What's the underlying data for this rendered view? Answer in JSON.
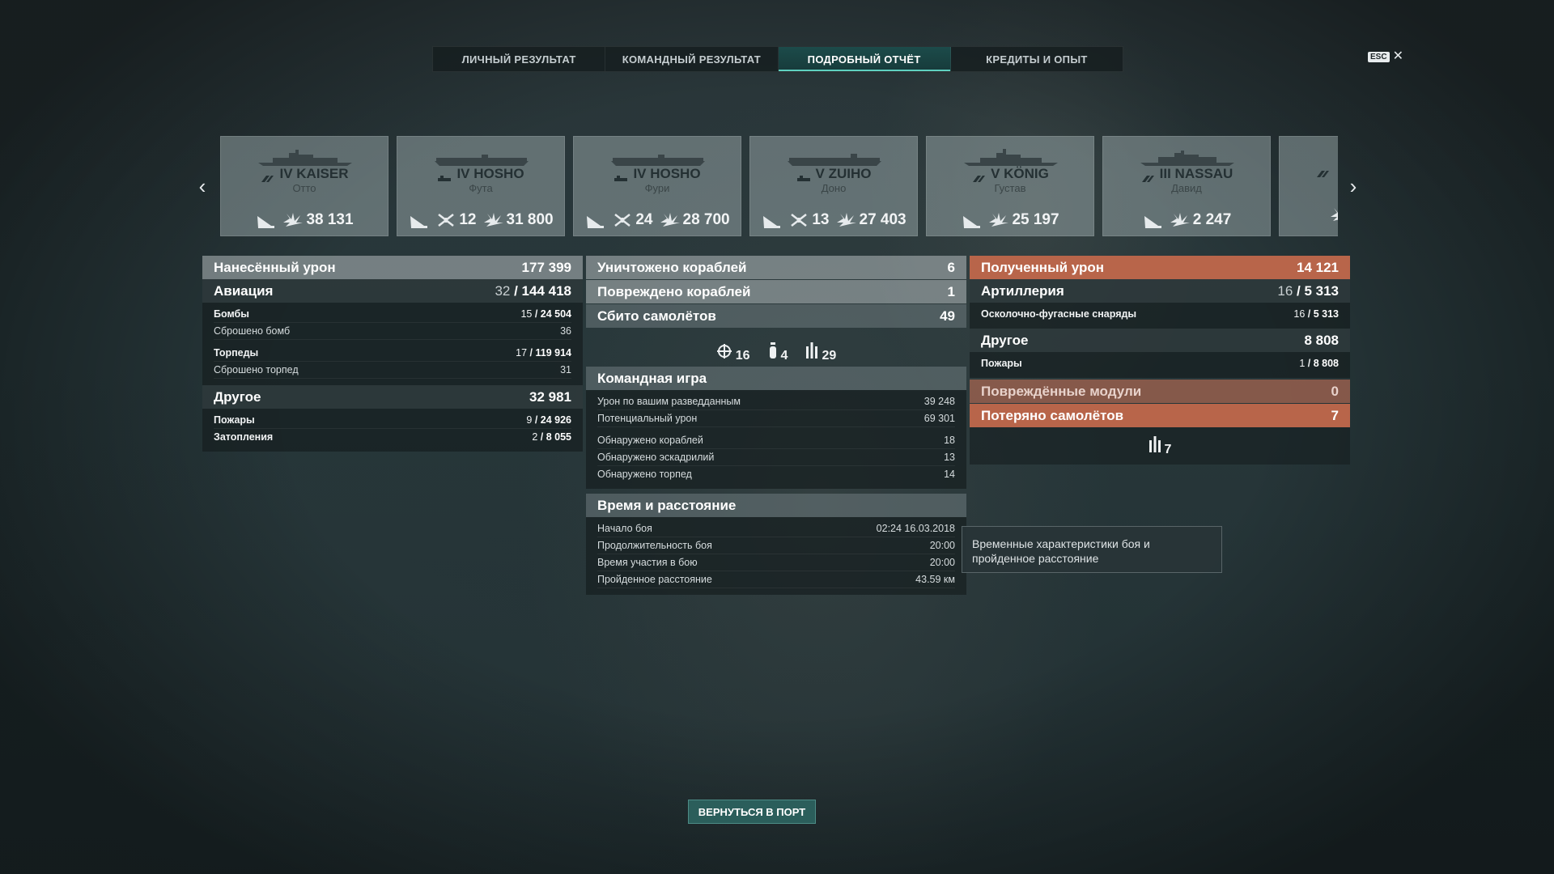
{
  "tabs": [
    {
      "label": "ЛИЧНЫЙ РЕЗУЛЬТАТ",
      "active": false
    },
    {
      "label": "КОМАНДНЫЙ РЕЗУЛЬТАТ",
      "active": false
    },
    {
      "label": "ПОДРОБНЫЙ ОТЧЁТ",
      "active": true
    },
    {
      "label": "КРЕДИТЫ И ОПЫТ",
      "active": false
    }
  ],
  "esc": {
    "key": "ESC",
    "close": "✕"
  },
  "ships": [
    {
      "tier_name": "IV KAISER",
      "player": "Отто",
      "planes": "",
      "damage": "38 131"
    },
    {
      "tier_name": "IV HOSHO",
      "player": "Фута",
      "planes": "12",
      "damage": "31 800"
    },
    {
      "tier_name": "IV HOSHO",
      "player": "Фури",
      "planes": "24",
      "damage": "28 700"
    },
    {
      "tier_name": "V ZUIHO",
      "player": "Доно",
      "planes": "13",
      "damage": "27 403"
    },
    {
      "tier_name": "V KÖNIG",
      "player": "Густав",
      "planes": "",
      "damage": "25 197"
    },
    {
      "tier_name": "III NASSAU",
      "player": "Давид",
      "planes": "",
      "damage": "2 247"
    }
  ],
  "left_panel": {
    "damage_dealt": {
      "label": "Нанесённый урон",
      "value": "177 399"
    },
    "aviation": {
      "label": "Авиация",
      "hits": "32",
      "value": "144 418"
    },
    "bombs": {
      "label": "Бомбы",
      "hits": "15",
      "value": "24 504"
    },
    "bombs_dropped": {
      "label": "Сброшено бомб",
      "value": "36"
    },
    "torpedoes": {
      "label": "Торпеды",
      "hits": "17",
      "value": "119 914"
    },
    "torpedoes_dropped": {
      "label": "Сброшено торпед",
      "value": "31"
    },
    "other": {
      "label": "Другое",
      "value": "32 981"
    },
    "fires": {
      "label": "Пожары",
      "hits": "9",
      "value": "24 926"
    },
    "flooding": {
      "label": "Затопления",
      "hits": "2",
      "value": "8 055"
    }
  },
  "middle_panel": {
    "destroyed": {
      "label": "Уничтожено кораблей",
      "value": "6"
    },
    "damaged": {
      "label": "Повреждено кораблей",
      "value": "1"
    },
    "planes_shot": {
      "label": "Сбито самолётов",
      "value": "49"
    },
    "plane_icons": {
      "fighters": "16",
      "bombers": "4",
      "torpedo": "29"
    },
    "team_play": {
      "label": "Командная игра",
      "rows": [
        {
          "label": "Урон по вашим разведданным",
          "value": "39 248"
        },
        {
          "label": "Потенциальный урон",
          "value": "69 301"
        },
        {
          "label": "Обнаружено кораблей",
          "value": "18"
        },
        {
          "label": "Обнаружено эскадрилий",
          "value": "13"
        },
        {
          "label": "Обнаружено торпед",
          "value": "14"
        }
      ]
    },
    "time": {
      "label": "Время и расстояние",
      "rows": [
        {
          "label": "Начало боя",
          "value": "02:24  16.03.2018"
        },
        {
          "label": "Продолжительность боя",
          "value": "20:00"
        },
        {
          "label": "Время участия в бою",
          "value": "20:00"
        },
        {
          "label": "Пройденное расстояние",
          "value": "43.59 км"
        }
      ]
    }
  },
  "right_panel": {
    "damage_received": {
      "label": "Полученный урон",
      "value": "14 121"
    },
    "artillery": {
      "label": "Артиллерия",
      "hits": "16",
      "value": "5 313"
    },
    "he_shells": {
      "label": "Осколочно-фугасные снаряды",
      "hits": "16",
      "value": "5 313"
    },
    "other": {
      "label": "Другое",
      "value": "8 808"
    },
    "fires": {
      "label": "Пожары",
      "hits": "1",
      "value": "8 808"
    },
    "modules": {
      "label": "Повреждённые модули",
      "value": "0"
    },
    "planes_lost": {
      "label": "Потеряно самолётов",
      "value": "7"
    },
    "planes_lost_icon": "7"
  },
  "tooltip": "Временные характеристики боя и пройденное расстояние",
  "return_button": "ВЕРНУТЬСЯ В ПОРТ",
  "colors": {
    "accent": "#2b5e5b",
    "orange": "#b8654a"
  }
}
